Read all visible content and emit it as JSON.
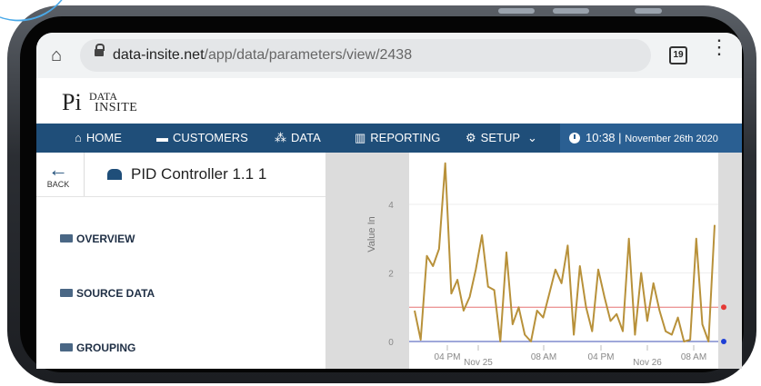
{
  "browser": {
    "url_host": "data-insite.net",
    "url_path": "/app/data/parameters/view/2438",
    "tab_count": "19"
  },
  "logo": {
    "pi": "Pi",
    "data": "DATA",
    "insite": "INSITE"
  },
  "nav": {
    "items": [
      {
        "label": "HOME",
        "icon": "home-icon"
      },
      {
        "label": "CUSTOMERS",
        "icon": "building-icon"
      },
      {
        "label": "DATA",
        "icon": "hierarchy-icon"
      },
      {
        "label": "REPORTING",
        "icon": "chart-icon"
      },
      {
        "label": "SETUP",
        "icon": "gears-icon"
      }
    ],
    "time": "10:38",
    "separator": "|",
    "date": "November 26th 2020"
  },
  "left": {
    "back_label": "BACK",
    "title": "PID Controller 1.1 1",
    "menu": [
      {
        "label": "OVERVIEW"
      },
      {
        "label": "SOURCE DATA"
      },
      {
        "label": "GROUPING"
      }
    ]
  },
  "chart_data": {
    "type": "line",
    "ylabel": "Value In",
    "ylim": [
      0,
      5.3
    ],
    "y_ticks": [
      "0",
      "2",
      "4"
    ],
    "x_ticks": [
      "04 PM",
      "Nov 25",
      "08 AM",
      "04 PM",
      "Nov 26",
      "08 AM"
    ],
    "series": [
      {
        "values": [
          0.9,
          0.05,
          2.5,
          2.2,
          2.7,
          5.2,
          1.4,
          1.8,
          0.9,
          1.3,
          2.1,
          3.1,
          1.6,
          1.5,
          0.0,
          2.6,
          0.5,
          1.0,
          0.2,
          0.0,
          0.9,
          0.7,
          1.4,
          2.1,
          1.7,
          2.8,
          0.2,
          2.2,
          1.0,
          0.3,
          2.1,
          1.3,
          0.6,
          0.8,
          0.3,
          3.0,
          0.2,
          2.0,
          0.6,
          1.7,
          0.9,
          0.3,
          0.2,
          0.7,
          0.0,
          0.05,
          3.0,
          0.5,
          0.0,
          3.4
        ]
      }
    ],
    "reference_lines": [
      {
        "value": 1.0,
        "color": "#e57373"
      },
      {
        "value": 0.0,
        "color": "#3f51b5"
      }
    ],
    "colors": {
      "line": "#b8913a",
      "marker_red": "#e53935",
      "marker_blue": "#1e3fd6"
    }
  }
}
